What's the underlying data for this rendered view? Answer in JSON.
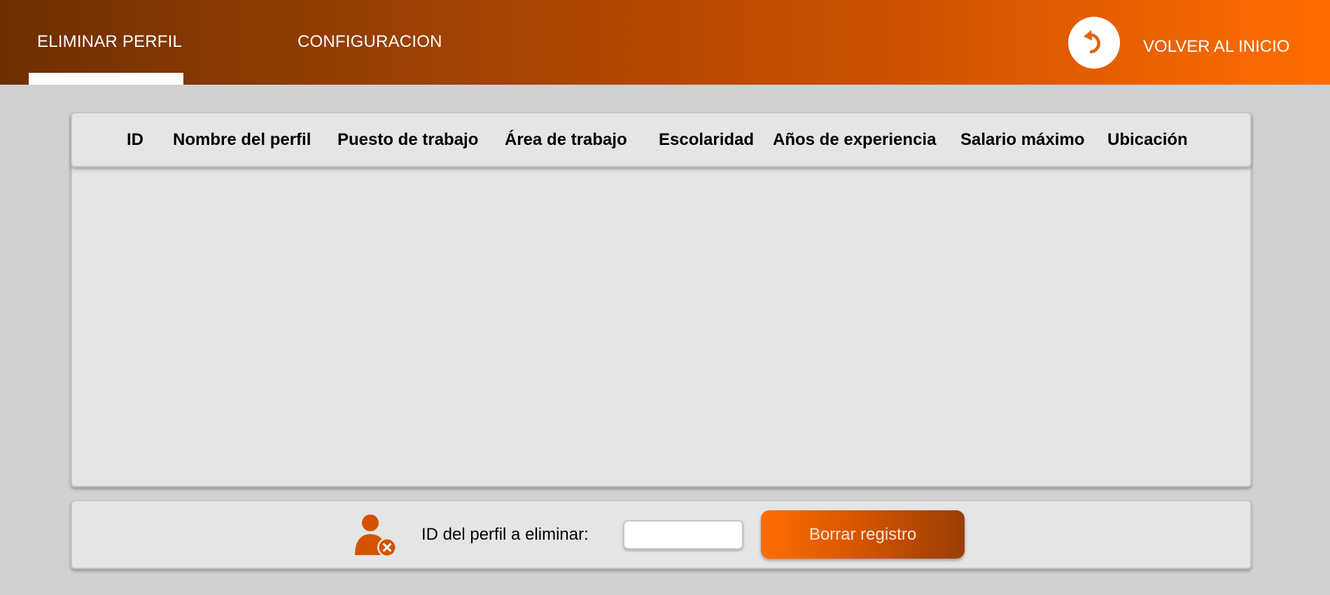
{
  "header": {
    "tabs": [
      {
        "label": "ELIMINAR PERFIL",
        "active": true
      },
      {
        "label": "CONFIGURACION",
        "active": false
      }
    ],
    "back_label": "VOLVER AL INICIO",
    "back_icon": "undo-arrow-icon"
  },
  "table": {
    "columns": [
      "ID",
      "Nombre del perfil",
      "Puesto de trabajo",
      "Área de trabajo",
      "Escolaridad",
      "Años de experiencia",
      "Salario máximo",
      "Ubicación"
    ],
    "rows": []
  },
  "form": {
    "icon": "user-remove-icon",
    "label": "ID del perfil a eliminar:",
    "input_value": "",
    "button_label": "Borrar registro"
  },
  "colors": {
    "accent": "#ff6d02",
    "header_dark": "#6e2f02",
    "panel": "#e5e5e5",
    "background": "#d1d1d1"
  }
}
